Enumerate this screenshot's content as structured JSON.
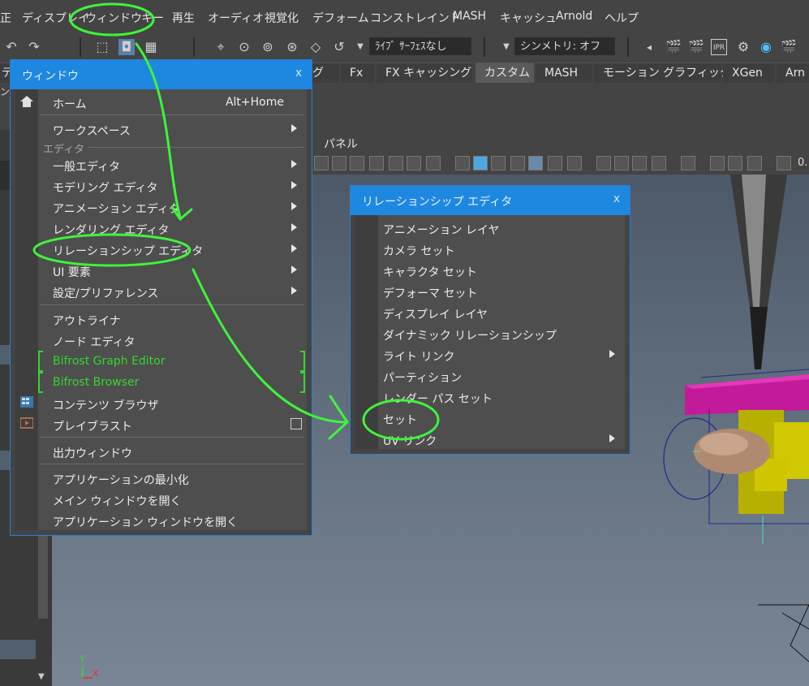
{
  "menubar": {
    "items": [
      "正",
      "ディスプレイ",
      "ウィンドウ",
      "キー",
      "再生",
      "オーディオ",
      "視覚化",
      "デフォーム",
      "コンストレイント",
      "MASH",
      "キャッシュ",
      "Arnold",
      "ヘルプ"
    ]
  },
  "toolbar": {
    "live_surface": "ﾗｲﾌﾞ ｻｰﾌｪｽなし",
    "symmetry": "シンメトリ: オフ",
    "ipr_label": "IPR"
  },
  "shelf": {
    "left_fragment": "デ",
    "tabs": [
      "グ",
      "Fx",
      "FX キャッシング",
      "カスタム",
      "MASH",
      "モーション グラフィックス",
      "XGen",
      "Arn"
    ],
    "tool_text": "ンを"
  },
  "panel": {
    "menu_label": "パネル",
    "field_fragment": "0."
  },
  "window_menu": {
    "title": "ウィンドウ",
    "close": "x",
    "home": "ホーム",
    "home_shortcut": "Alt+Home",
    "workspace": "ワークスペース",
    "editors_section": "エディタ",
    "general_editors": "一般エディタ",
    "modeling_editors": "モデリング エディタ",
    "animation_editors": "アニメーション エディタ",
    "rendering_editors": "レンダリング エディタ",
    "relationship_editors": "リレーションシップ エディタ",
    "ui_elements": "UI 要素",
    "settings_prefs": "設定/プリファレンス",
    "outliner": "アウトライナ",
    "node_editor": "ノード エディタ",
    "bifrost_graph": "Bifrost Graph Editor",
    "bifrost_browser": "Bifrost Browser",
    "content_browser": "コンテンツ ブラウザ",
    "playblast": "プレイブラスト",
    "output_window": "出力ウィンドウ",
    "minimize_app": "アプリケーションの最小化",
    "open_main_window": "メイン ウィンドウを開く",
    "open_app_window": "アプリケーション ウィンドウを開く"
  },
  "relationship_menu": {
    "title": "リレーションシップ エディタ",
    "close": "x",
    "items": [
      "アニメーション レイヤ",
      "カメラ セット",
      "キャラクタ セット",
      "デフォーマ セット",
      "ディスプレイ レイヤ",
      "ダイナミック リレーションシップ",
      "ライト リンク",
      "パーティション",
      "レンダー パス セット",
      "セット",
      "UV リンク"
    ]
  },
  "axis": {
    "y": "Y",
    "x": "X"
  },
  "colors": {
    "menu_title_bg": "#1e88e0",
    "green_text": "#35d62e",
    "annotation": "#3ef53b"
  }
}
